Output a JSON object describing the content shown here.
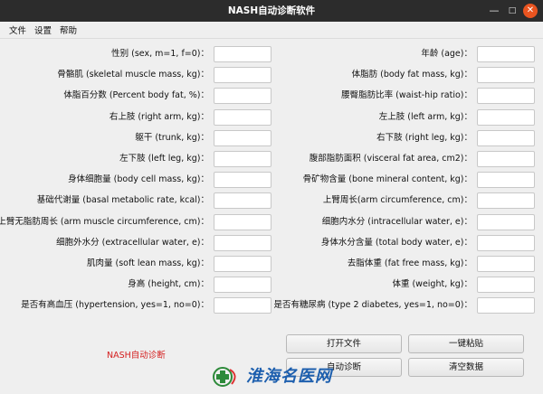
{
  "window": {
    "title": "NASH自动诊断软件"
  },
  "controls": {
    "minimize": "—",
    "maximize": "□",
    "close": "✕"
  },
  "menu": [
    "文件",
    "设置",
    "帮助"
  ],
  "left_fields": [
    "性别 (sex, m=1, f=0)：",
    "骨骼肌 (skeletal muscle mass, kg)：",
    "体脂百分数 (Percent body fat, %)：",
    "右上肢 (right arm, kg)：",
    "躯干 (trunk, kg)：",
    "左下肢 (left leg, kg)：",
    "身体细胞量 (body cell mass, kg)：",
    "基础代谢量 (basal metabolic rate, kcal)：",
    "上臂无脂肪周长 (arm muscle circumference, cm)：",
    "细胞外水分 (extracellular water, e)：",
    "肌肉量 (soft lean mass, kg)：",
    "身高 (height, cm)：",
    "是否有高血压 (hypertension, yes=1, no=0)："
  ],
  "right_fields": [
    "年龄 (age)：",
    "体脂肪 (body fat mass, kg)：",
    "腰臀脂肪比率 (waist-hip ratio)：",
    "左上肢 (left arm, kg)：",
    "右下肢 (right leg, kg)：",
    "腹部脂肪面积 (visceral fat area, cm2)：",
    "骨矿物含量 (bone mineral content, kg)：",
    "上臂周长(arm circumference, cm)：",
    "细胞内水分 (intracellular water, e)：",
    "身体水分含量 (total body water, e)：",
    "去脂体重 (fat free mass, kg)：",
    "体重 (weight, kg)：",
    "是否有糖尿病 (type 2 diabetes, yes=1, no=0)："
  ],
  "buttons": {
    "open_file": "打开文件",
    "paste": "一键粘贴",
    "diagnose": "自动诊断",
    "clear": "清空数据"
  },
  "status_text": "NASH自动诊断",
  "watermark_text": "淮海名医网"
}
